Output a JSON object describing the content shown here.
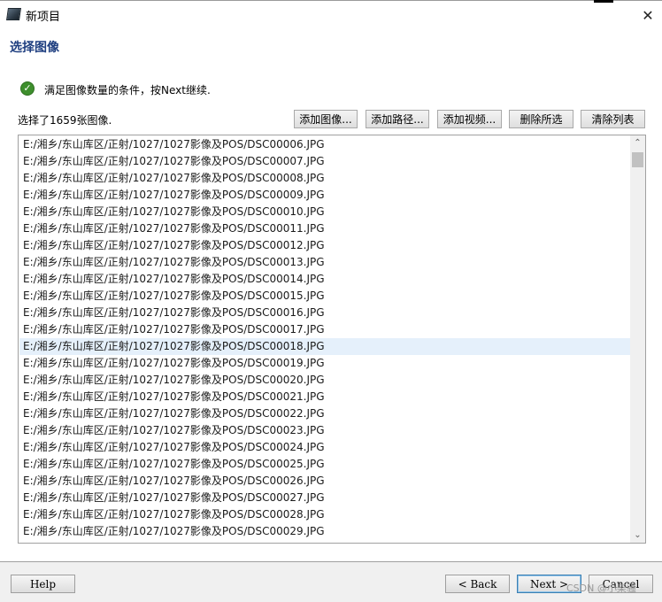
{
  "window": {
    "title": "新项目"
  },
  "header": {
    "title": "选择图像"
  },
  "status": {
    "message": "满足图像数量的条件，按Next继续."
  },
  "summary": {
    "count_text": "选择了1659张图像."
  },
  "toolbar": {
    "add_images": "添加图像...",
    "add_path": "添加路径...",
    "add_video": "添加视频...",
    "delete_selected": "删除所选",
    "clear_list": "清除列表"
  },
  "files": [
    "E:/湘乡/东山库区/正射/1027/1027影像及POS/DSC00006.JPG",
    "E:/湘乡/东山库区/正射/1027/1027影像及POS/DSC00007.JPG",
    "E:/湘乡/东山库区/正射/1027/1027影像及POS/DSC00008.JPG",
    "E:/湘乡/东山库区/正射/1027/1027影像及POS/DSC00009.JPG",
    "E:/湘乡/东山库区/正射/1027/1027影像及POS/DSC00010.JPG",
    "E:/湘乡/东山库区/正射/1027/1027影像及POS/DSC00011.JPG",
    "E:/湘乡/东山库区/正射/1027/1027影像及POS/DSC00012.JPG",
    "E:/湘乡/东山库区/正射/1027/1027影像及POS/DSC00013.JPG",
    "E:/湘乡/东山库区/正射/1027/1027影像及POS/DSC00014.JPG",
    "E:/湘乡/东山库区/正射/1027/1027影像及POS/DSC00015.JPG",
    "E:/湘乡/东山库区/正射/1027/1027影像及POS/DSC00016.JPG",
    "E:/湘乡/东山库区/正射/1027/1027影像及POS/DSC00017.JPG",
    "E:/湘乡/东山库区/正射/1027/1027影像及POS/DSC00018.JPG",
    "E:/湘乡/东山库区/正射/1027/1027影像及POS/DSC00019.JPG",
    "E:/湘乡/东山库区/正射/1027/1027影像及POS/DSC00020.JPG",
    "E:/湘乡/东山库区/正射/1027/1027影像及POS/DSC00021.JPG",
    "E:/湘乡/东山库区/正射/1027/1027影像及POS/DSC00022.JPG",
    "E:/湘乡/东山库区/正射/1027/1027影像及POS/DSC00023.JPG",
    "E:/湘乡/东山库区/正射/1027/1027影像及POS/DSC00024.JPG",
    "E:/湘乡/东山库区/正射/1027/1027影像及POS/DSC00025.JPG",
    "E:/湘乡/东山库区/正射/1027/1027影像及POS/DSC00026.JPG",
    "E:/湘乡/东山库区/正射/1027/1027影像及POS/DSC00027.JPG",
    "E:/湘乡/东山库区/正射/1027/1027影像及POS/DSC00028.JPG",
    "E:/湘乡/东山库区/正射/1027/1027影像及POS/DSC00029.JPG"
  ],
  "selected_index": 12,
  "footer": {
    "help": "Help",
    "back": "< Back",
    "next": "Next >",
    "cancel": "Cancel"
  },
  "watermark": "CSDN @小柴骚",
  "icons": {
    "app": "app-icon",
    "close": "close-icon",
    "status": "check-circle-icon",
    "scroll_up": "chevron-up-icon",
    "scroll_down": "chevron-down-icon"
  },
  "colors": {
    "header_title": "#1f3f80",
    "status_ok": "#3e8f2d",
    "selected_row": "#e5f0fb",
    "footer_bg": "#f0f0f0"
  }
}
